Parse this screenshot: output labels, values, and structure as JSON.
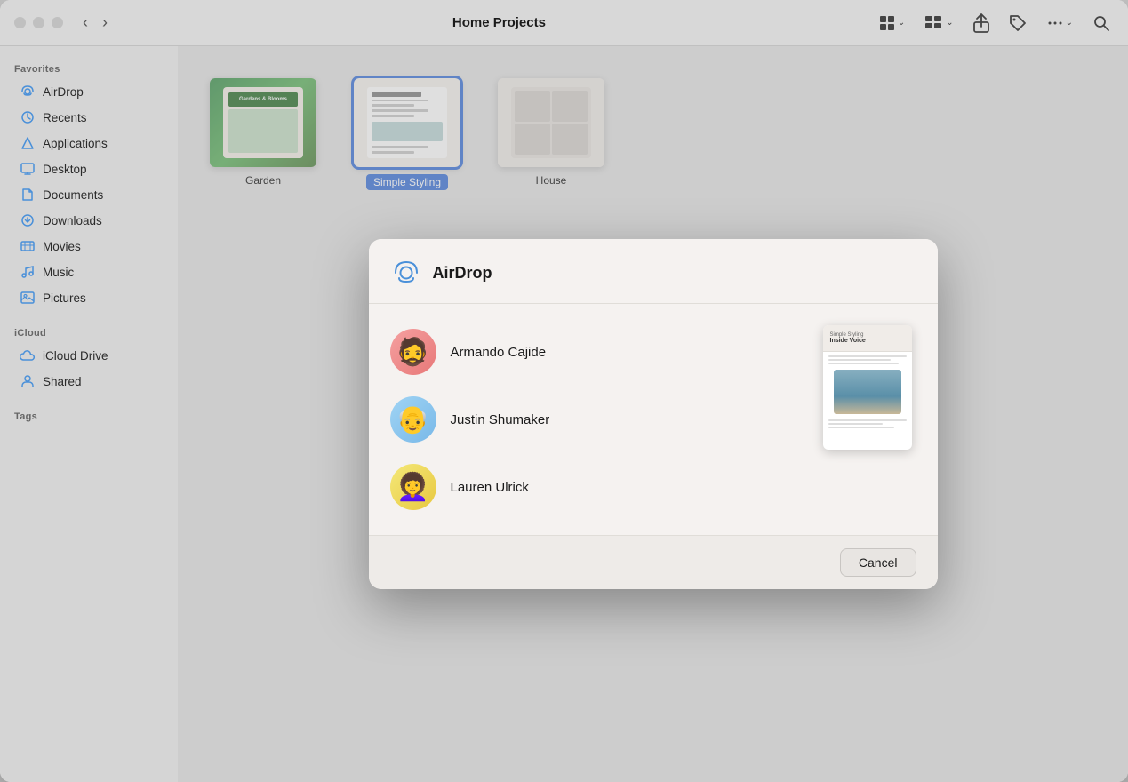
{
  "window": {
    "title": "Home Projects"
  },
  "toolbar": {
    "back_label": "‹",
    "forward_label": "›",
    "view_grid_label": "⊞",
    "share_label": "↑",
    "tag_label": "🏷",
    "more_label": "···",
    "search_label": "🔍"
  },
  "sidebar": {
    "favorites_label": "Favorites",
    "icloud_label": "iCloud",
    "tags_label": "Tags",
    "items": [
      {
        "id": "airdrop",
        "label": "AirDrop",
        "icon": "airdrop"
      },
      {
        "id": "recents",
        "label": "Recents",
        "icon": "clock"
      },
      {
        "id": "applications",
        "label": "Applications",
        "icon": "rocket"
      },
      {
        "id": "desktop",
        "label": "Desktop",
        "icon": "desktop"
      },
      {
        "id": "documents",
        "label": "Documents",
        "icon": "document"
      },
      {
        "id": "downloads",
        "label": "Downloads",
        "icon": "download"
      },
      {
        "id": "movies",
        "label": "Movies",
        "icon": "film"
      },
      {
        "id": "music",
        "label": "Music",
        "icon": "music"
      },
      {
        "id": "pictures",
        "label": "Pictures",
        "icon": "photo"
      }
    ],
    "icloud_items": [
      {
        "id": "icloud-drive",
        "label": "iCloud Drive",
        "icon": "cloud"
      },
      {
        "id": "shared",
        "label": "Shared",
        "icon": "folder-shared"
      }
    ]
  },
  "files": [
    {
      "id": "garden",
      "label": "Garden",
      "selected": false
    },
    {
      "id": "simple-styling",
      "label": "Simple Styling",
      "selected": true
    },
    {
      "id": "house",
      "label": "House",
      "selected": false
    }
  ],
  "dialog": {
    "title": "AirDrop",
    "recipients": [
      {
        "id": "armando",
        "name": "Armando Cajide",
        "emoji": "🧔"
      },
      {
        "id": "justin",
        "name": "Justin Shumaker",
        "emoji": "🧓"
      },
      {
        "id": "lauren",
        "name": "Lauren Ulrick",
        "emoji": "👩‍🦱"
      }
    ],
    "preview": {
      "header_title": "Simple Styling",
      "header_sub": "Inside Voice"
    },
    "cancel_label": "Cancel"
  }
}
